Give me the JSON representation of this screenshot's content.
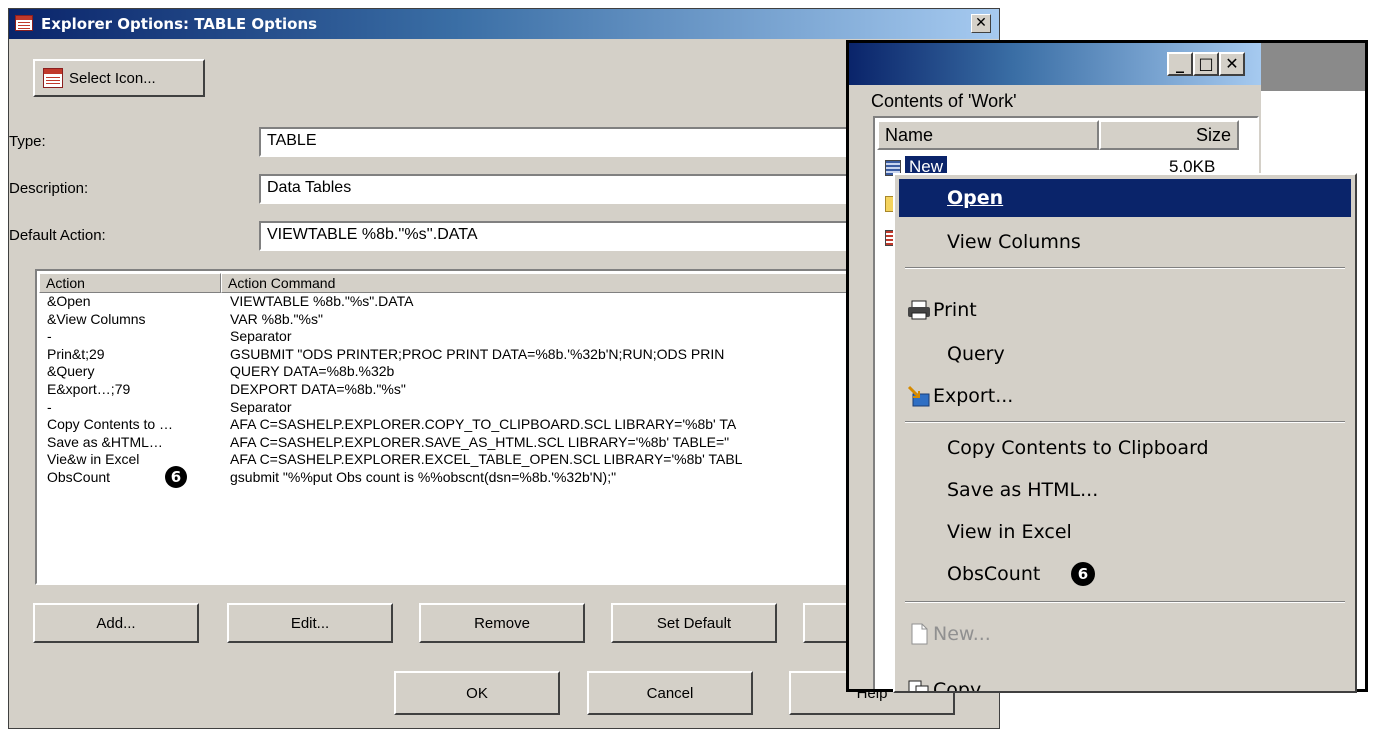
{
  "dialog": {
    "title": "Explorer Options: TABLE Options",
    "select_icon_button": "Select Icon...",
    "type_label": "Type:",
    "type_value": "TABLE",
    "description_label": "Description:",
    "description_value": "Data Tables",
    "default_action_label": "Default Action:",
    "default_action_value": "VIEWTABLE %8b.''%s''.DATA",
    "list_headers": [
      "Action",
      "Action Command"
    ],
    "actions": [
      {
        "action": "&Open",
        "command": "VIEWTABLE %8b.\"%s\".DATA"
      },
      {
        "action": "&View Columns",
        "command": "VAR %8b.\"%s\""
      },
      {
        "action": "-",
        "command": "Separator"
      },
      {
        "action": "Prin&t;29",
        "command": "GSUBMIT \"ODS PRINTER;PROC PRINT DATA=%8b.'%32b'N;RUN;ODS PRIN"
      },
      {
        "action": "&Query",
        "command": "QUERY DATA=%8b.%32b"
      },
      {
        "action": "E&xport…;79",
        "command": "DEXPORT DATA=%8b.\"%s\""
      },
      {
        "action": "-",
        "command": "Separator"
      },
      {
        "action": "Copy Contents to …",
        "command": "AFA C=SASHELP.EXPLORER.COPY_TO_CLIPBOARD.SCL LIBRARY='%8b' TA"
      },
      {
        "action": "Save as &HTML…",
        "command": "AFA C=SASHELP.EXPLORER.SAVE_AS_HTML.SCL LIBRARY='%8b' TABLE=\""
      },
      {
        "action": "Vie&w in Excel",
        "command": "AFA C=SASHELP.EXPLORER.EXCEL_TABLE_OPEN.SCL LIBRARY='%8b' TABL"
      },
      {
        "action": "ObsCount",
        "command": "gsubmit \"%%put Obs count is %%obscnt(dsn=%8b.'%32b'N);\""
      }
    ],
    "badge": "6",
    "buttons": {
      "add": "Add...",
      "edit": "Edit...",
      "remove": "Remove",
      "set_default": "Set Default",
      "ok": "OK",
      "cancel": "Cancel",
      "help": "Help"
    }
  },
  "explorer": {
    "contents_label": "Contents of 'Work'",
    "col_name": "Name",
    "col_size": "Size",
    "file_name": "New",
    "file_size": "5.0KB"
  },
  "menu": {
    "items": [
      {
        "label": "Open",
        "icon": ""
      },
      {
        "label": "View Columns",
        "icon": ""
      },
      {
        "label": "Print",
        "icon": "printer-icon"
      },
      {
        "label": "Query",
        "icon": ""
      },
      {
        "label": "Export...",
        "icon": "export-icon"
      },
      {
        "label": "Copy Contents to Clipboard",
        "icon": ""
      },
      {
        "label": "Save as HTML...",
        "icon": ""
      },
      {
        "label": "View in Excel",
        "icon": ""
      },
      {
        "label": "ObsCount",
        "icon": ""
      },
      {
        "label": "New...",
        "icon": "new-file-icon"
      },
      {
        "label": "Copy",
        "icon": "copy-icon"
      }
    ]
  },
  "colors": {
    "titlebar": "#0a246a",
    "face": "#d4d0c8",
    "selection": "#0a246a"
  }
}
